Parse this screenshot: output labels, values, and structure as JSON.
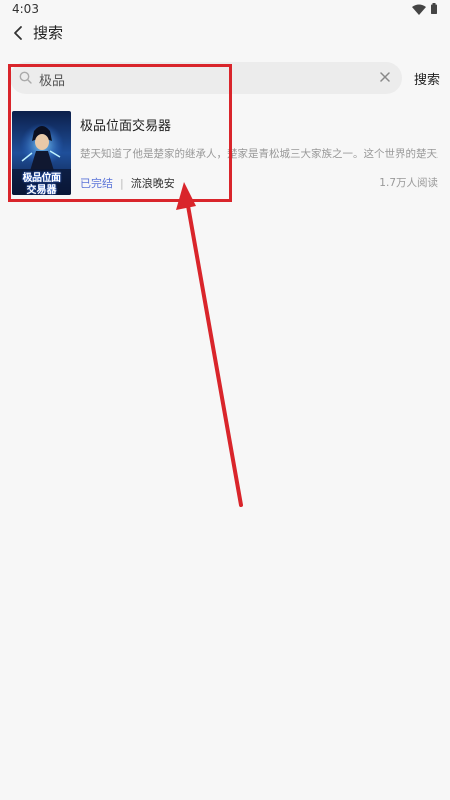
{
  "status_bar": {
    "time": "4:03"
  },
  "nav": {
    "title": "搜索"
  },
  "search": {
    "value": "极品",
    "placeholder": "",
    "button_label": "搜索"
  },
  "results": [
    {
      "title": "极品位面交易器",
      "description": "楚天知道了他是楚家的继承人，楚家是青松城三大家族之一。这个世界的楚天从小",
      "status": "已完结",
      "separator": "|",
      "author": "流浪晚安",
      "reads": "1.7万人阅读",
      "cover_lines": [
        "极品位面",
        "交易器"
      ]
    }
  ],
  "colors": {
    "accent": "#5b74d8",
    "annotation": "#d9252b",
    "background": "#f7f7f7"
  }
}
